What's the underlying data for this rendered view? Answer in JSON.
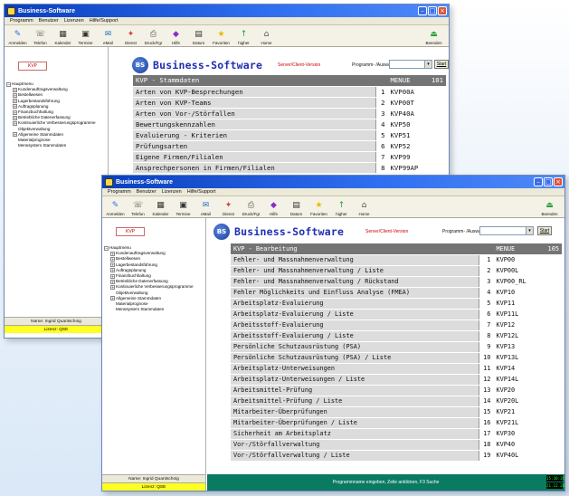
{
  "app_title": "Business-Software",
  "menubar": [
    "Programm",
    "Benutzer",
    "Lizenzen",
    "Hilfe/Support"
  ],
  "toolbar": [
    {
      "label": "Anmelden",
      "icon": "login-icon"
    },
    {
      "label": "Telefon",
      "icon": "phone-icon"
    },
    {
      "label": "Kalender",
      "icon": "calendar-icon"
    },
    {
      "label": "Termine",
      "icon": "appointments-icon"
    },
    {
      "label": "eMail",
      "icon": "email-icon"
    },
    {
      "label": "Dienst",
      "icon": "service-icon"
    },
    {
      "label": "Druck/Fgr",
      "icon": "print-icon"
    },
    {
      "label": "Hilfe",
      "icon": "help-icon"
    },
    {
      "label": "Datum",
      "icon": "date-icon"
    },
    {
      "label": "Favoriten",
      "icon": "favorites-icon"
    },
    {
      "label": "higher",
      "icon": "higher-icon"
    },
    {
      "label": "Home",
      "icon": "home-icon"
    }
  ],
  "toolbar_exit": "Beenden",
  "module_button": "KVP",
  "brand_title": "Business-Software",
  "server_version": "Server/Client-Version",
  "program_select_label": "Programm- /Auswahl",
  "start_label": "Start",
  "tree": {
    "root": "Hauptmenu",
    "items": [
      {
        "label": "Kundenauftragsverwaltung",
        "expandable": true
      },
      {
        "label": "Bestellwesen",
        "expandable": true
      },
      {
        "label": "Lagerbestandsführung",
        "expandable": true
      },
      {
        "label": "Auftragsplanung",
        "expandable": true
      },
      {
        "label": "Finanzbuchhaltung",
        "expandable": true
      },
      {
        "label": "Betriebliche Datenerfassung",
        "expandable": true
      },
      {
        "label": "Kontinuierliche Verbesserungsprogramme",
        "expandable": true
      },
      {
        "label": "Objektverwaltung",
        "expandable": false
      },
      {
        "label": "Allgemeine Stammdaten",
        "expandable": true
      },
      {
        "label": "Materialprognose",
        "expandable": false
      },
      {
        "label": "Menüsystem Stammdaten",
        "expandable": false
      }
    ]
  },
  "user_name": "Name: Ingrid Quantschnig",
  "license": "Lizenz: QSE",
  "back_window": {
    "header": {
      "title": "KVP - Stammdaten",
      "menu_label": "MENUE",
      "menu_number": "101"
    },
    "rows": [
      {
        "title": "Arten von KVP-Besprechungen",
        "num": "1",
        "code": "KVP00A"
      },
      {
        "title": "Arten von KVP-Teams",
        "num": "2",
        "code": "KVP00T"
      },
      {
        "title": "Arten von Vor-/Störfallen",
        "num": "3",
        "code": "KVP40A"
      },
      {
        "title": "Bewertungskennzahlen",
        "num": "4",
        "code": "KVP50"
      },
      {
        "title": "Evaluierung - Kriterien",
        "num": "5",
        "code": "KVP51"
      },
      {
        "title": "Prüfungsarten",
        "num": "6",
        "code": "KVP52"
      },
      {
        "title": "Eigene Firmen/Filialen",
        "num": "7",
        "code": "KVP99"
      },
      {
        "title": "Ansprechpersonen in Firmen/Filialen",
        "num": "8",
        "code": "KVP99AP"
      }
    ]
  },
  "front_window": {
    "header": {
      "title": "KVP - Bearbeitung",
      "menu_label": "MENUE",
      "menu_number": "105"
    },
    "rows": [
      {
        "title": "Fehler- und Massnahmenverwaltung",
        "num": "1",
        "code": "KVP00"
      },
      {
        "title": "Fehler- und Massnahmenverwaltung / Liste",
        "num": "2",
        "code": "KVP00L"
      },
      {
        "title": "Fehler- und Massnahmenverwaltung / Rückstand",
        "num": "3",
        "code": "KVP00_RL"
      },
      {
        "title": "Fehler Möglichkeits und Einfluss Analyse (FMEA)",
        "num": "4",
        "code": "KVP10"
      },
      {
        "title": "Arbeitsplatz-Evaluierung",
        "num": "5",
        "code": "KVP11"
      },
      {
        "title": "Arbeitsplatz-Evaluierung / Liste",
        "num": "6",
        "code": "KVP11L"
      },
      {
        "title": "Arbeitsstoff-Evaluierung",
        "num": "7",
        "code": "KVP12"
      },
      {
        "title": "Arbeitsstoff-Evaluierung / Liste",
        "num": "8",
        "code": "KVP12L"
      },
      {
        "title": "Persönliche Schutzausrüstung (PSA)",
        "num": "9",
        "code": "KVP13"
      },
      {
        "title": "Persönliche Schutzausrüstung (PSA) / Liste",
        "num": "10",
        "code": "KVP13L"
      },
      {
        "title": "Arbeitsplatz-Unterweisungen",
        "num": "11",
        "code": "KVP14"
      },
      {
        "title": "Arbeitsplatz-Unterweisungen / Liste",
        "num": "12",
        "code": "KVP14L"
      },
      {
        "title": "Arbeitsmittel-Prüfung",
        "num": "13",
        "code": "KVP20"
      },
      {
        "title": "Arbeitsmittel-Prüfung / Liste",
        "num": "14",
        "code": "KVP20L"
      },
      {
        "title": "Mitarbeiter-Überprüfungen",
        "num": "15",
        "code": "KVP21"
      },
      {
        "title": "Mitarbeiter-Überprüfungen / Liste",
        "num": "16",
        "code": "KVP21L"
      },
      {
        "title": "Sicherheit am Arbeitsplatz",
        "num": "17",
        "code": "KVP30"
      },
      {
        "title": "Vor-/Störfallverwaltung",
        "num": "18",
        "code": "KVP40"
      },
      {
        "title": "Vor-/Störfallverwaltung / Liste",
        "num": "19",
        "code": "KVP40L"
      }
    ]
  },
  "status_text": "Programmname eingeben, Zeile anklicken, F3 Suche",
  "clock_time": "15:30:35",
  "clock_date": "21.12.2011",
  "colors": {
    "title_bar": "#0a3fbd",
    "brand_text": "#1f2fb0",
    "table_header": "#747474",
    "table_row": "#dcdcdc",
    "status_bar": "#0a7a61",
    "license_bg": "#ffff22",
    "accent_red": "#d10000"
  }
}
